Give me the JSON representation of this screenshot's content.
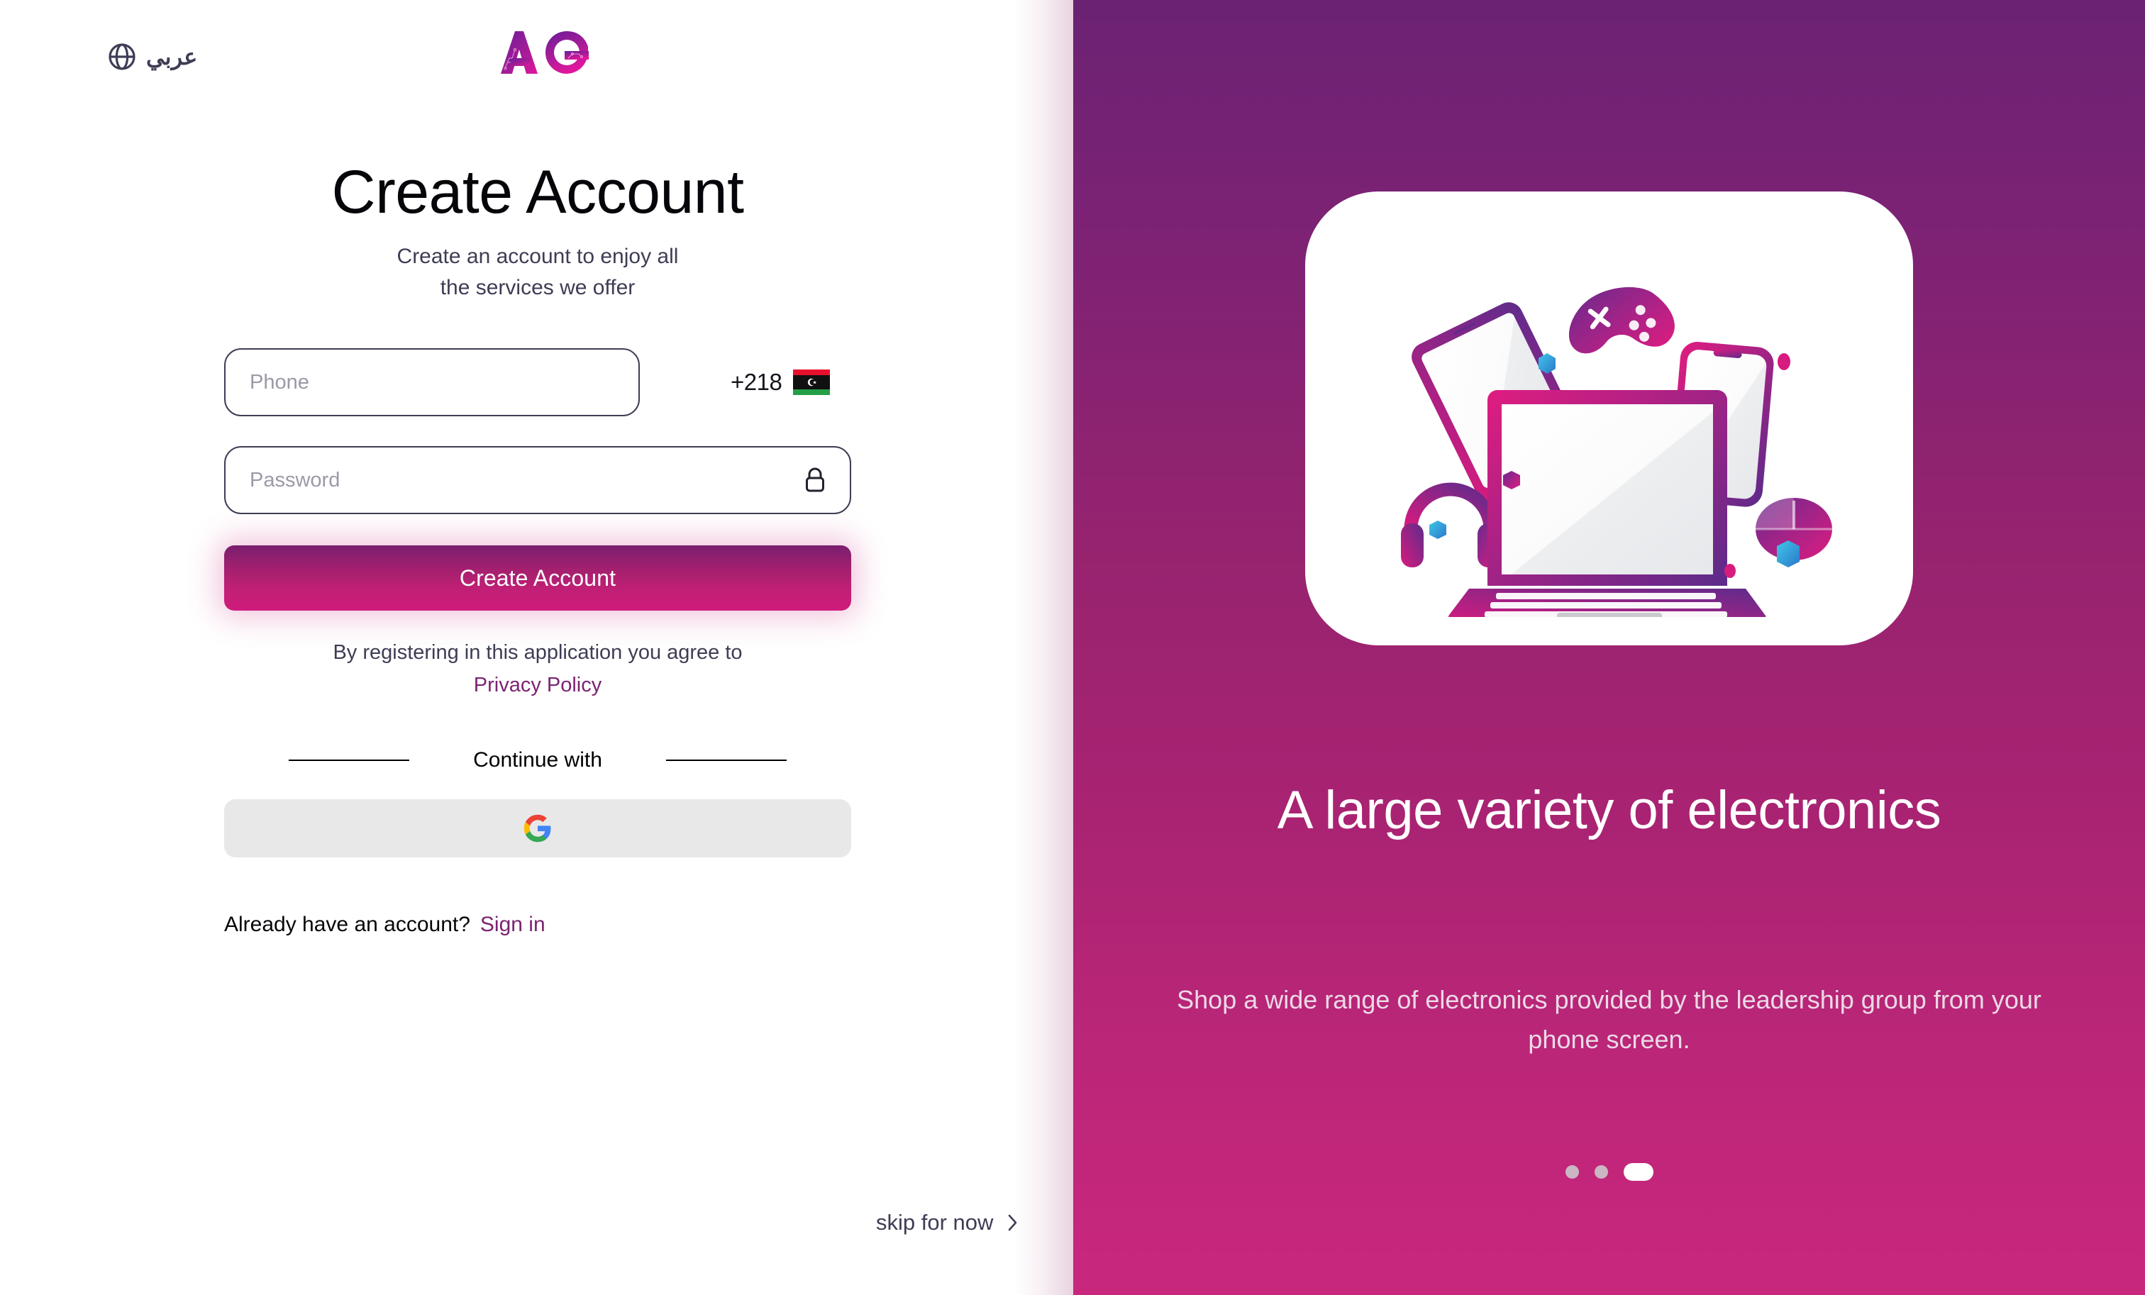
{
  "language_switcher": {
    "label": "عربي",
    "icon": "globe-icon"
  },
  "brand": {
    "logo_text": "AG",
    "colors": {
      "purple": "#7B1FA2",
      "magenta": "#D6179C"
    }
  },
  "form": {
    "title": "Create Account",
    "subtitle": "Create an account to enjoy all\nthe services we offer",
    "subtitle_line1": "Create an account to enjoy all",
    "subtitle_line2": "the services we offer",
    "phone": {
      "placeholder": "Phone",
      "value": "",
      "country_code": "+218",
      "flag": "libya-flag"
    },
    "password": {
      "placeholder": "Password",
      "value": "",
      "icon": "lock-icon"
    },
    "submit_label": "Create Account",
    "terms_text": "By registering in this application you agree to",
    "privacy_policy_label": "Privacy Policy",
    "continue_label": "Continue with",
    "google_button": {
      "icon": "google-icon",
      "label": ""
    },
    "signin_prompt": "Already have an account?",
    "signin_label": "Sign in"
  },
  "skip": {
    "label": "skip for now",
    "icon": "chevron-right-icon"
  },
  "promo": {
    "headline": "A large variety of electronics",
    "subtext": "Shop a wide range of electronics provided by the leadership group from your phone screen.",
    "illustration": "electronics-devices-illustration",
    "carousel": {
      "total": 3,
      "active_index": 2
    }
  },
  "colors": {
    "accent_purple": "#7B2471",
    "accent_magenta": "#C9277E",
    "panel_gradient_top": "#6B2273",
    "panel_gradient_bottom": "#C9277E",
    "text_dark": "#3E3D55",
    "placeholder": "#9a9aa8"
  }
}
